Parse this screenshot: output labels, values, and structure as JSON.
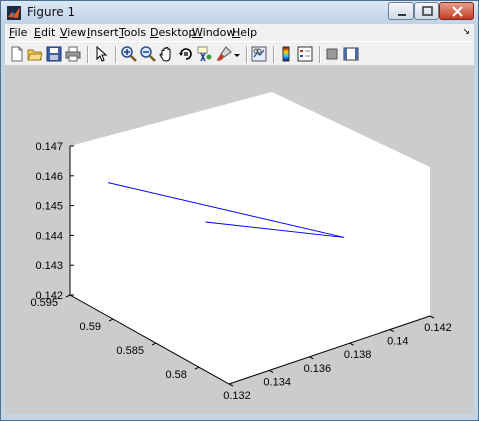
{
  "window": {
    "title": "Figure 1",
    "icon": "matlab-icon",
    "controls": [
      "minimize-icon",
      "maximize-icon",
      "close-icon"
    ]
  },
  "menu": [
    {
      "label": "File",
      "mnemonic": "F"
    },
    {
      "label": "Edit",
      "mnemonic": "E"
    },
    {
      "label": "View",
      "mnemonic": "V"
    },
    {
      "label": "Insert",
      "mnemonic": "I"
    },
    {
      "label": "Tools",
      "mnemonic": "T"
    },
    {
      "label": "Desktop",
      "mnemonic": "D"
    },
    {
      "label": "Window",
      "mnemonic": "W"
    },
    {
      "label": "Help",
      "mnemonic": "H"
    }
  ],
  "toolbar": [
    "new-figure-icon",
    "open-file-icon",
    "save-icon",
    "print-icon",
    "edit-plot-icon",
    "zoom-in-icon",
    "zoom-out-icon",
    "pan-icon",
    "rotate-3d-icon",
    "data-cursor-icon",
    "brush-icon",
    "brush-dropdown-icon",
    "link-plot-icon",
    "insert-colorbar-icon",
    "insert-legend-icon",
    "hide-plot-tools-icon",
    "show-plot-tools-icon"
  ],
  "chart_data": {
    "type": "line",
    "projection": "3d",
    "title": "",
    "xlabel": "",
    "ylabel": "",
    "zlabel": "",
    "x_ticks": [
      "0.132",
      "0.134",
      "0.136",
      "0.138",
      "0.14",
      "0.142"
    ],
    "y_ticks": [
      "0.58",
      "0.585",
      "0.59",
      "0.595"
    ],
    "z_ticks": [
      "0.142",
      "0.143",
      "0.144",
      "0.145",
      "0.146",
      "0.147"
    ],
    "xlim": [
      0.132,
      0.142
    ],
    "ylim": [
      0.5765,
      0.595
    ],
    "zlim": [
      0.142,
      0.147
    ],
    "series": [
      {
        "color": "#0000ff",
        "points": [
          {
            "x": 0.1333,
            "y": 0.5936,
            "z": 0.1457
          },
          {
            "x": 0.1394,
            "y": 0.5804,
            "z": 0.1446
          },
          {
            "x": 0.1381,
            "y": 0.5935,
            "z": 0.1433
          }
        ]
      }
    ],
    "grid": false,
    "box_color": "#ffffff",
    "figure_color": "#cccccc"
  }
}
